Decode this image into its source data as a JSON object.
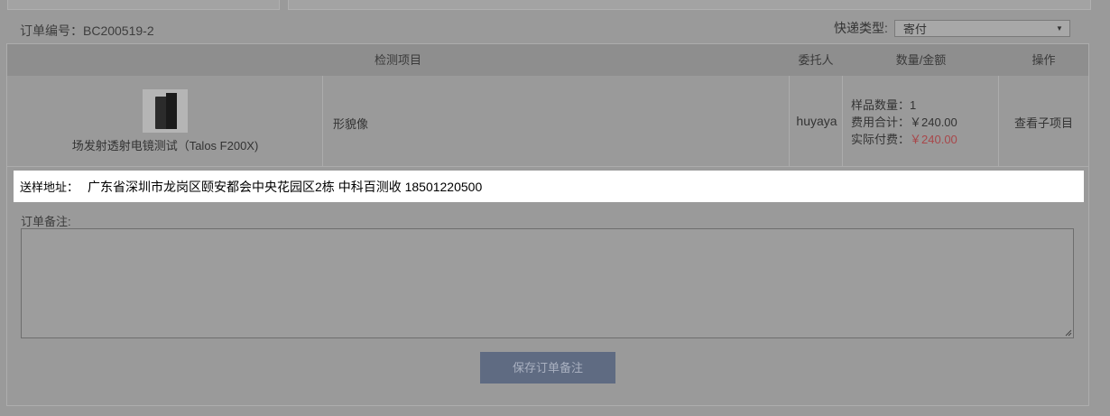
{
  "order": {
    "number_label": "订单编号：BC200519-2",
    "express_label": "快递类型:",
    "express_value": "寄付"
  },
  "table": {
    "headers": [
      "检测项目",
      "委托人",
      "数量/金额",
      "操作"
    ],
    "row": {
      "product_name": "场发射透射电镜测试（Talos F200X)",
      "item": "形貌像",
      "client": "huyaya",
      "sample_qty": "样品数量：1",
      "fee_total": "费用合计：￥240.00",
      "actual_fee_label": "实际付费：",
      "actual_fee_value": "￥240.00",
      "action": "查看子项目"
    }
  },
  "shipping": {
    "label": "送样地址：",
    "address": "广东省深圳市龙岗区颐安都会中央花园区2栋 中科百测收 18501220500"
  },
  "remark": {
    "label": "订单备注:",
    "value": ""
  },
  "save_button": "保存订单备注",
  "colors": {
    "accent": "#5f6b82",
    "highlight": "#ffffff",
    "price_red": "#a8474a"
  }
}
